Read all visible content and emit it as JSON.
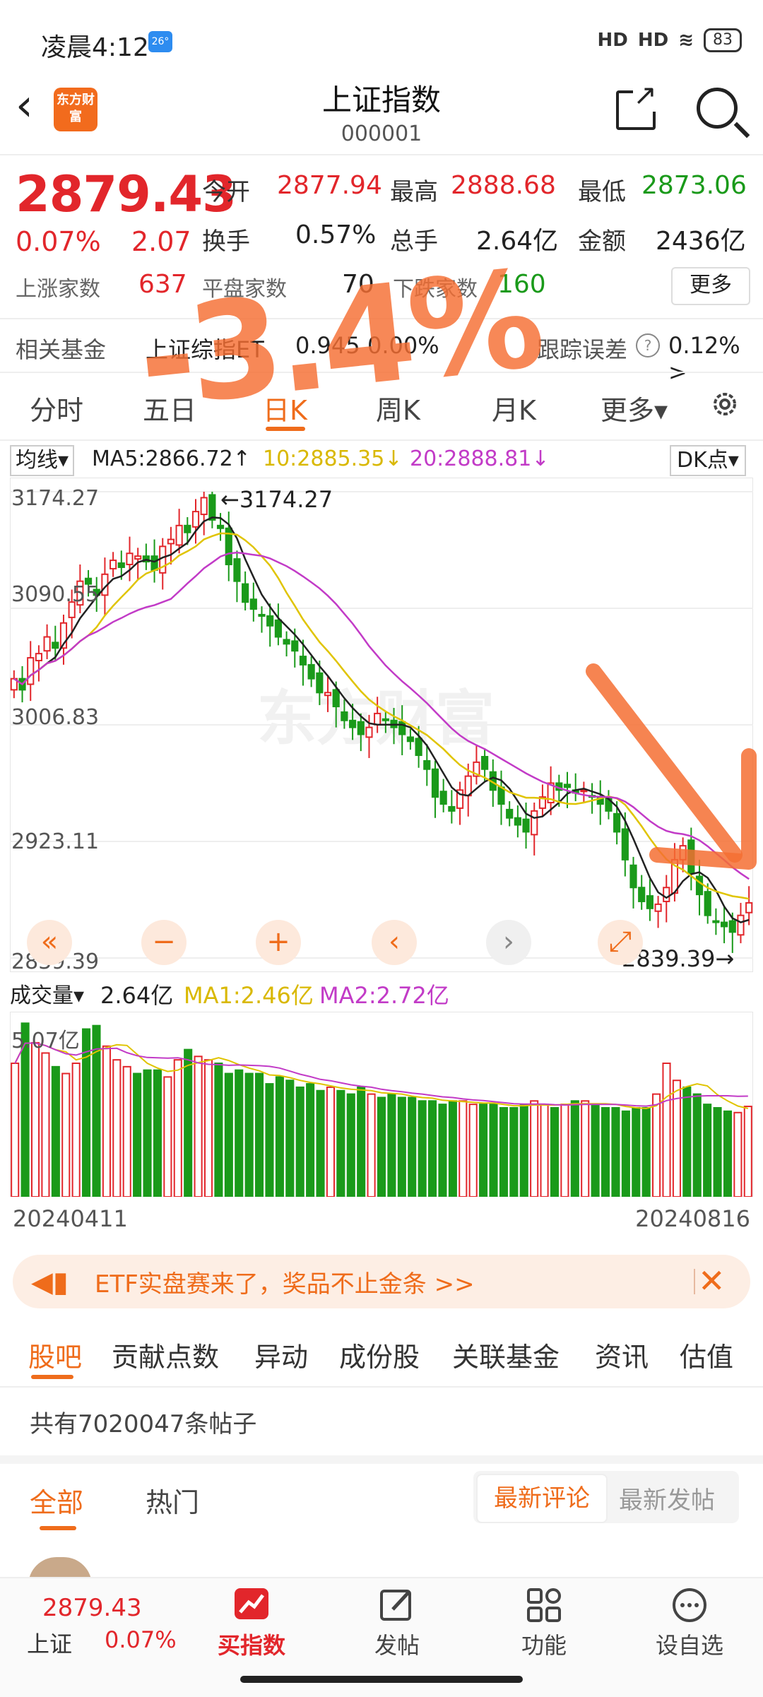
{
  "status": {
    "time": "凌晨4:12",
    "weather": "26°",
    "sig1": "HD",
    "sig2": "HD",
    "battery": "83"
  },
  "header": {
    "logo": "东方财富",
    "title": "上证指数",
    "code": "000001"
  },
  "quote": {
    "price": "2879.43",
    "change_pct": "0.07%",
    "change_pts": "2.07",
    "open_label": "今开",
    "open": "2877.94",
    "high_label": "最高",
    "high": "2888.68",
    "low_label": "最低",
    "low": "2873.06",
    "turnover_label": "换手",
    "turnover": "0.57%",
    "volume_label": "总手",
    "volume": "2.64亿",
    "amount_label": "金额",
    "amount": "2436亿",
    "up_label": "上涨家数",
    "up": "637",
    "flat_label": "平盘家数",
    "flat": "70",
    "down_label": "下跌家数",
    "down": "160",
    "more": "更多"
  },
  "fund": {
    "label": "相关基金",
    "name": "上证综指ET",
    "price": "0.945",
    "pct": "0.00%",
    "track_label": "跟踪误差",
    "track_val": "0.12% >"
  },
  "tabs": [
    "分时",
    "五日",
    "日K",
    "周K",
    "月K",
    "更多▾"
  ],
  "ma": {
    "select": "均线▾",
    "ma5": "MA5:2866.72↑",
    "ma10": "10:2885.35↓",
    "ma20": "20:2888.81↓",
    "dk": "DK点▾"
  },
  "kchart": {
    "y_labels": [
      "3174.27",
      "3090.55",
      "3006.83",
      "2923.11",
      "2839.39"
    ],
    "high_marker": "←3174.27",
    "low_marker": "2839.39→",
    "watermark": "东方财富"
  },
  "volume": {
    "select": "成交量▾",
    "value": "2.64亿",
    "ma1": "MA1:2.46亿",
    "ma2": "MA2:2.72亿",
    "max_label": "5.07亿"
  },
  "dates": {
    "start": "20240411",
    "end": "20240816"
  },
  "chart_data": {
    "type": "candlestick",
    "title": "上证指数 日K",
    "x_range": [
      "20240411",
      "20240816"
    ],
    "ylim": [
      2839.39,
      3174.27
    ],
    "grid": true,
    "close_series": [
      3040,
      3032,
      3055,
      3058,
      3070,
      3062,
      3080,
      3095,
      3110,
      3108,
      3100,
      3115,
      3125,
      3120,
      3130,
      3128,
      3124,
      3118,
      3135,
      3140,
      3150,
      3145,
      3160,
      3170,
      3154,
      3148,
      3122,
      3110,
      3095,
      3090,
      3085,
      3078,
      3070,
      3065,
      3060,
      3050,
      3040,
      3030,
      3030,
      3020,
      3010,
      3005,
      3000,
      3005,
      3015,
      3010,
      3005,
      3000,
      2995,
      2985,
      2975,
      2955,
      2950,
      2945,
      2960,
      2970,
      2980,
      2975,
      2960,
      2950,
      2940,
      2935,
      2930,
      2945,
      2955,
      2965,
      2960,
      2962,
      2958,
      2960,
      2955,
      2950,
      2945,
      2930,
      2910,
      2890,
      2880,
      2875,
      2878,
      2890,
      2910,
      2920,
      2900,
      2885,
      2870,
      2865,
      2862,
      2858,
      2870,
      2879
    ],
    "volume_yi": [
      3.9,
      5.07,
      4.5,
      4.2,
      3.8,
      3.6,
      3.9,
      4.9,
      5.0,
      4.4,
      4.0,
      3.8,
      3.6,
      3.7,
      3.7,
      3.5,
      4.0,
      4.3,
      4.1,
      4.0,
      3.9,
      3.6,
      3.7,
      3.6,
      3.6,
      3.3,
      3.5,
      3.4,
      3.2,
      3.3,
      3.1,
      3.2,
      3.1,
      3.0,
      3.2,
      3.0,
      2.9,
      3.0,
      2.9,
      2.9,
      2.8,
      2.8,
      2.7,
      2.8,
      2.8,
      2.7,
      2.7,
      2.7,
      2.6,
      2.6,
      2.7,
      2.8,
      2.7,
      2.6,
      2.7,
      2.8,
      2.8,
      2.7,
      2.6,
      2.6,
      2.5,
      2.6,
      2.6,
      3.0,
      3.9,
      3.4,
      3.2,
      3.0,
      2.7,
      2.6,
      2.5,
      2.46,
      2.64
    ]
  },
  "annotation": {
    "text": "-3.4%"
  },
  "banner": {
    "text": "ETF实盘赛来了，奖品不止金条 >>"
  },
  "community": {
    "tabs": [
      "股吧",
      "贡献点数",
      "异动",
      "成份股",
      "关联基金",
      "资讯",
      "估值"
    ],
    "post_count": "共有7020047条帖子",
    "filter_all": "全部",
    "filter_hot": "热门",
    "sort_latest": "最新评论",
    "sort_new": "最新发帖"
  },
  "bottom_nav": {
    "index_price": "2879.43",
    "index_name": "上证",
    "index_pct": "0.07%",
    "buy": "买指数",
    "post": "发帖",
    "func": "功能",
    "watch": "设自选"
  }
}
